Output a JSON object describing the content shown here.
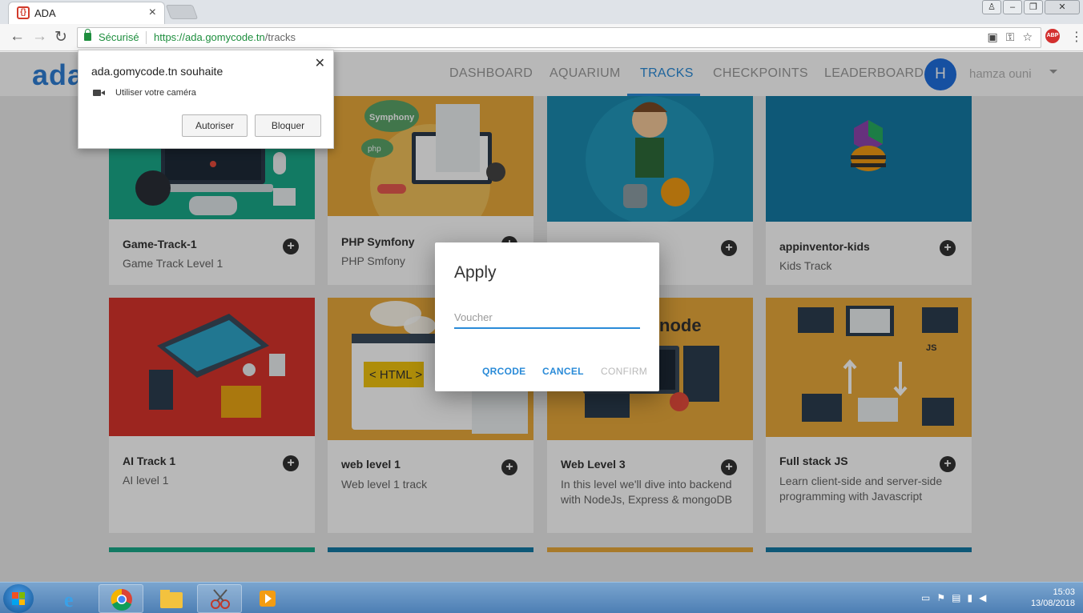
{
  "browser": {
    "tab_title": "ADA",
    "secure_label": "Sécurisé",
    "url_host": "https://ada.gomycode.tn",
    "url_path": "/tracks"
  },
  "header": {
    "logo": "ada",
    "nav": [
      "DASHBOARD",
      "AQUARIUM",
      "TRACKS",
      "CHECKPOINTS",
      "LEADERBOARD"
    ],
    "active_nav": "TRACKS",
    "avatar_letter": "H",
    "username": "hamza ouni"
  },
  "permission": {
    "title": "ada.gomycode.tn souhaite",
    "request": "Utiliser votre caméra",
    "allow": "Autoriser",
    "block": "Bloquer"
  },
  "modal": {
    "title": "Apply",
    "voucher_placeholder": "Voucher",
    "qrcode": "QRCODE",
    "cancel": "CANCEL",
    "confirm": "CONFIRM"
  },
  "cards": [
    {
      "title": "Game-Track-1",
      "subtitle": "Game Track Level 1",
      "color": "#1aa98a"
    },
    {
      "title": "PHP Symfony",
      "subtitle": "PHP Smfony",
      "color": "#e9a93b"
    },
    {
      "title": "",
      "subtitle": "",
      "color": "#1b8bb0"
    },
    {
      "title": "appinventor-kids",
      "subtitle": "Kids Track",
      "color": "#147aa6"
    },
    {
      "title": "AI Track 1",
      "subtitle": "AI level 1",
      "color": "#d8342c"
    },
    {
      "title": "web level 1",
      "subtitle": "Web level 1 track",
      "color": "#e9a93b"
    },
    {
      "title": "Web Level 3",
      "subtitle": "In this level we'll dive into backend with NodeJs, Express & mongoDB",
      "color": "#e9a93b"
    },
    {
      "title": "Full stack JS",
      "subtitle": "Learn client-side and server-side programming with Javascript",
      "color": "#e9a93b"
    }
  ],
  "image_labels": {
    "symfony": "Symphony",
    "php": "php",
    "html": "< HTML >",
    "node": "node",
    "js": "JS"
  },
  "strips": [
    "#1aa98a",
    "#147aa6",
    "#e9a93b",
    "#147aa6"
  ],
  "taskbar": {
    "time": "15:03",
    "date": "13/08/2018"
  }
}
